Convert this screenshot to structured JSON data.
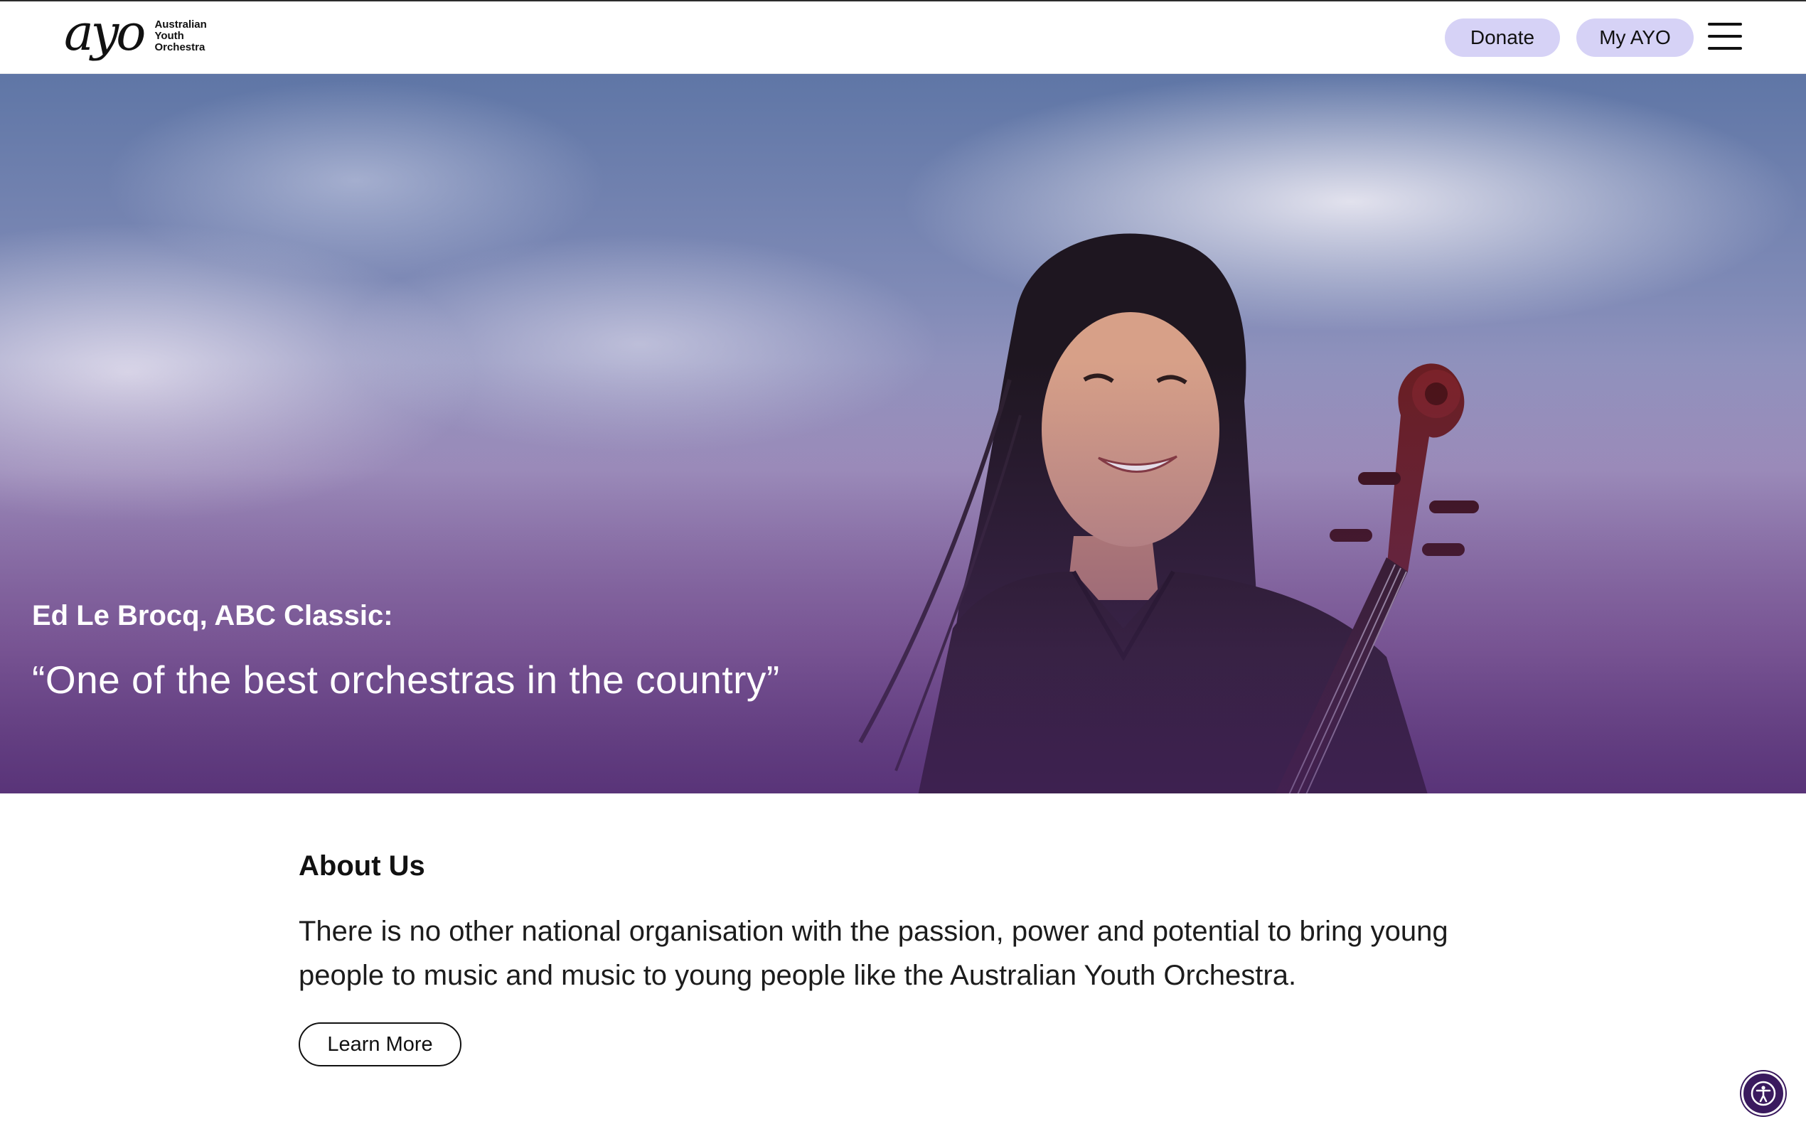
{
  "header": {
    "logo_word": "ayo",
    "logo_lines": [
      "Australian",
      "Youth",
      "Orchestra"
    ],
    "donate_label": "Donate",
    "myayo_label": "My AYO",
    "menu_icon": "hamburger-menu-icon"
  },
  "hero": {
    "quote_author": "Ed Le Brocq, ABC Classic:",
    "quote_text": "“One of the best orchestras in the country”"
  },
  "about": {
    "heading": "About Us",
    "body": "There is no other national organisation with the passion, power and potential to bring young people to music and music to young people like the Australian Youth Orchestra.",
    "button_label": "Learn More"
  },
  "accessibility": {
    "icon": "accessibility-icon",
    "color": "#3a1a5e"
  },
  "colors": {
    "pill_bg": "#d6d2f6",
    "hero_tint": "#6a4a8c"
  }
}
